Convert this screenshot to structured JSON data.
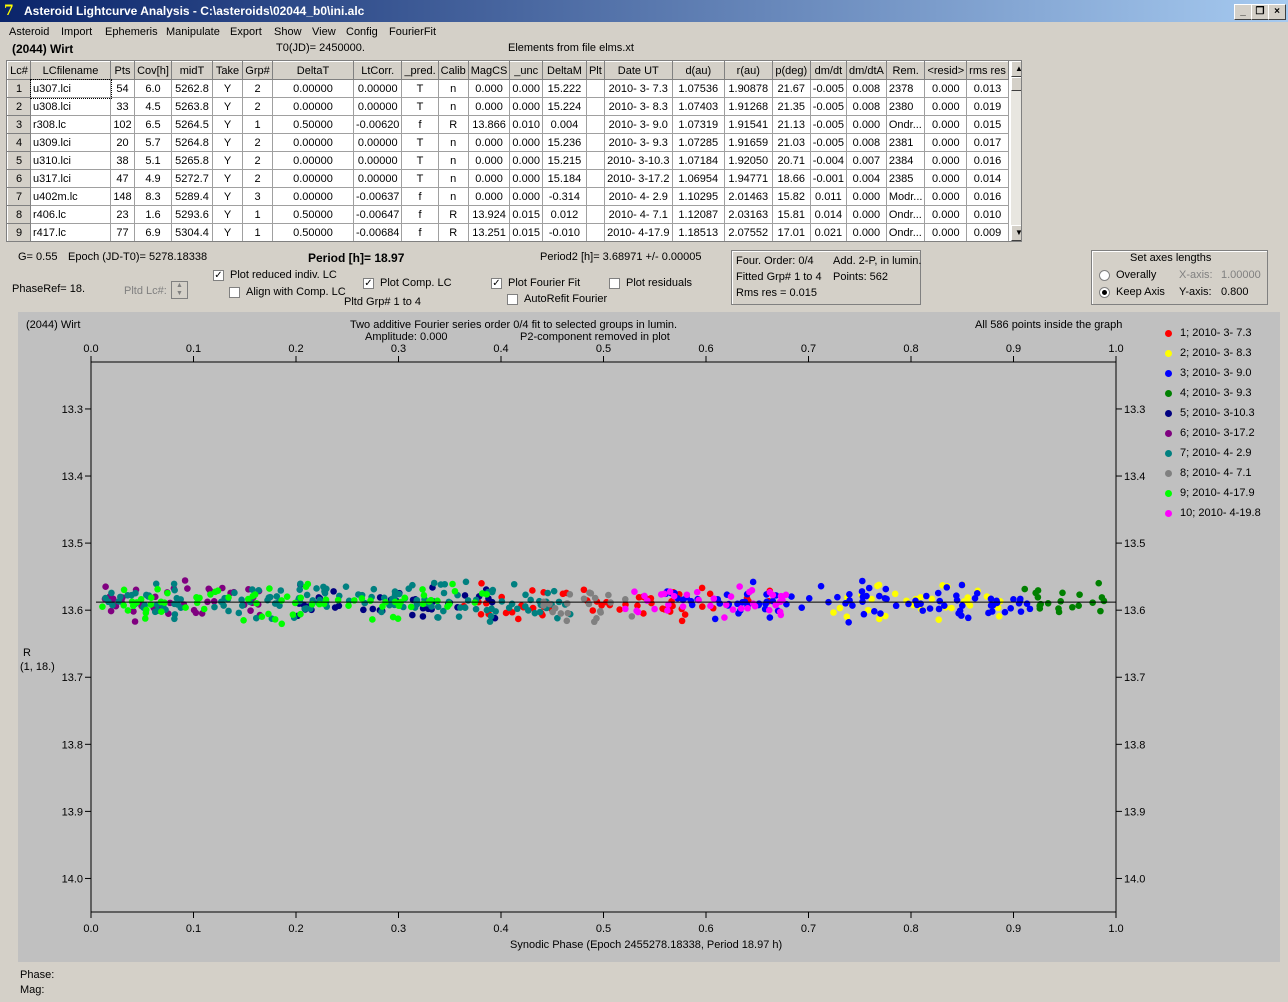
{
  "window": {
    "title": "Asteroid Lightcurve Analysis - C:\\asteroids\\02044_b0\\ini.alc",
    "minimize_label": "_",
    "restore_label": "❐",
    "close_label": "×"
  },
  "menu": [
    "Asteroid",
    "Import",
    "Ephemeris",
    "Manipulate",
    "Export",
    "Show",
    "View",
    "Config",
    "FourierFit"
  ],
  "header": {
    "object": "(2044) Wirt",
    "t0": "T0(JD)= 2450000.",
    "elements": "Elements from file elms.xt"
  },
  "table": {
    "columns": [
      "Lc#",
      "LCfilename",
      "Pts",
      "Cov[h]",
      "midT",
      "Take",
      "Grp#",
      "DeltaT",
      "LtCorr.",
      "_pred.",
      "Calib",
      "MagCS",
      "_unc",
      "DeltaM",
      "Plt",
      "Date UT",
      "d(au)",
      "r(au)",
      "p(deg)",
      "dm/dt",
      "dm/dtA",
      "Rem.",
      "<resid>",
      "rms res"
    ],
    "rows": [
      [
        "1",
        "u307.lci",
        "54",
        "6.0",
        "5262.8",
        "Y",
        "2",
        "0.00000",
        "0.00000",
        "T",
        "n",
        "0.000",
        "0.000",
        "15.222",
        "",
        "2010- 3- 7.3",
        "1.07536",
        "1.90878",
        "21.67",
        "-0.005",
        "0.008",
        "2378",
        "0.000",
        "0.013"
      ],
      [
        "2",
        "u308.lci",
        "33",
        "4.5",
        "5263.8",
        "Y",
        "2",
        "0.00000",
        "0.00000",
        "T",
        "n",
        "0.000",
        "0.000",
        "15.224",
        "",
        "2010- 3- 8.3",
        "1.07403",
        "1.91268",
        "21.35",
        "-0.005",
        "0.008",
        "2380",
        "0.000",
        "0.019"
      ],
      [
        "3",
        "r308.lc",
        "102",
        "6.5",
        "5264.5",
        "Y",
        "1",
        "0.50000",
        "-0.00620",
        "f",
        "R",
        "13.866",
        "0.010",
        "0.004",
        "",
        "2010- 3- 9.0",
        "1.07319",
        "1.91541",
        "21.13",
        "-0.005",
        "0.000",
        "Ondr...",
        "0.000",
        "0.015"
      ],
      [
        "4",
        "u309.lci",
        "20",
        "5.7",
        "5264.8",
        "Y",
        "2",
        "0.00000",
        "0.00000",
        "T",
        "n",
        "0.000",
        "0.000",
        "15.236",
        "",
        "2010- 3- 9.3",
        "1.07285",
        "1.91659",
        "21.03",
        "-0.005",
        "0.008",
        "2381",
        "0.000",
        "0.017"
      ],
      [
        "5",
        "u310.lci",
        "38",
        "5.1",
        "5265.8",
        "Y",
        "2",
        "0.00000",
        "0.00000",
        "T",
        "n",
        "0.000",
        "0.000",
        "15.215",
        "",
        "2010- 3-10.3",
        "1.07184",
        "1.92050",
        "20.71",
        "-0.004",
        "0.007",
        "2384",
        "0.000",
        "0.016"
      ],
      [
        "6",
        "u317.lci",
        "47",
        "4.9",
        "5272.7",
        "Y",
        "2",
        "0.00000",
        "0.00000",
        "T",
        "n",
        "0.000",
        "0.000",
        "15.184",
        "",
        "2010- 3-17.2",
        "1.06954",
        "1.94771",
        "18.66",
        "-0.001",
        "0.004",
        "2385",
        "0.000",
        "0.014"
      ],
      [
        "7",
        "u402m.lc",
        "148",
        "8.3",
        "5289.4",
        "Y",
        "3",
        "0.00000",
        "-0.00637",
        "f",
        "n",
        "0.000",
        "0.000",
        "-0.314",
        "",
        "2010- 4- 2.9",
        "1.10295",
        "2.01463",
        "15.82",
        "0.011",
        "0.000",
        "Modr...",
        "0.000",
        "0.016"
      ],
      [
        "8",
        "r406.lc",
        "23",
        "1.6",
        "5293.6",
        "Y",
        "1",
        "0.50000",
        "-0.00647",
        "f",
        "R",
        "13.924",
        "0.015",
        "0.012",
        "",
        "2010- 4- 7.1",
        "1.12087",
        "2.03163",
        "15.81",
        "0.014",
        "0.000",
        "Ondr...",
        "0.000",
        "0.010"
      ],
      [
        "9",
        "r417.lc",
        "77",
        "6.9",
        "5304.4",
        "Y",
        "1",
        "0.50000",
        "-0.00684",
        "f",
        "R",
        "13.251",
        "0.015",
        "-0.010",
        "",
        "2010- 4-17.9",
        "1.18513",
        "2.07552",
        "17.01",
        "0.021",
        "0.000",
        "Ondr...",
        "0.000",
        "0.009"
      ]
    ]
  },
  "controls": {
    "g": "G= 0.55",
    "epoch": "Epoch (JD-T0)= 5278.18338",
    "period": "Period [h]= 18.97",
    "period2": "Period2 [h]= 3.68971 +/- 0.00005",
    "phaseref": "PhaseRef= 18.",
    "pltd_lc": "Pltd Lc#:",
    "plot_reduced": "Plot reduced indiv. LC",
    "align_comp": "Align with Comp. LC",
    "plot_comp": "Plot Comp. LC",
    "pltd_grp": "Pltd Grp#  1   to   4",
    "plot_fourier": "Plot Fourier Fit",
    "autorefit": "AutoRefit Fourier",
    "plot_residuals": "Plot residuals",
    "four_order": "Four. Order:  0/4",
    "add2p": "Add. 2-P, in lumin.",
    "fitted_grp": "Fitted Grp# 1 to 4",
    "points": "Points: 562",
    "rms": "Rms res     = 0.015",
    "axes_title": "Set axes lengths",
    "overally": "Overally",
    "keep_axis": "Keep Axis",
    "xaxis_label": "X-axis:",
    "xaxis_value": "1.00000",
    "yaxis_label": "Y-axis:",
    "yaxis_value": "0.800"
  },
  "plot": {
    "object": "(2044) Wirt",
    "subtitle1": "Two additive Fourier series order 0/4 fit to selected groups in lumin.",
    "subtitle2": "Amplitude: 0.000",
    "subtitle3": "P2-component removed in plot",
    "points_note": "All 586 points inside the graph",
    "ylabel1": "R",
    "ylabel2": "(1, 18.)",
    "xlabel": "Synodic Phase (Epoch 2455278.18338, Period 18.97 h)"
  },
  "chart_data": {
    "type": "scatter",
    "xlim": [
      0,
      1
    ],
    "ylim": [
      14.05,
      13.23
    ],
    "y_inverted": true,
    "xticks": [
      "0.0",
      "0.1",
      "0.2",
      "0.3",
      "0.4",
      "0.5",
      "0.6",
      "0.7",
      "0.8",
      "0.9",
      "1.0"
    ],
    "yticks": [
      "13.3",
      "13.4",
      "13.5",
      "13.6",
      "13.7",
      "13.8",
      "13.9",
      "14.0"
    ],
    "fit_line": 13.588,
    "series": [
      {
        "name": "1; 2010- 3- 7.3",
        "color": "#ff0000",
        "range": [
          0.35,
          0.67
        ],
        "density": 60
      },
      {
        "name": "2; 2010- 3- 8.3",
        "color": "#ffff00",
        "range": [
          0.72,
          0.89
        ],
        "density": 35
      },
      {
        "name": "3; 2010- 3- 9.0",
        "color": "#0000ff",
        "range": [
          0.56,
          0.92
        ],
        "density": 100
      },
      {
        "name": "4; 2010- 3- 9.3",
        "color": "#008000",
        "range": [
          0.91,
          0.99
        ],
        "density": 20
      },
      {
        "name": "5; 2010- 3-10.3",
        "color": "#000080",
        "range": [
          0.2,
          0.4
        ],
        "density": 38
      },
      {
        "name": "6; 2010- 3-17.2",
        "color": "#800080",
        "range": [
          0.0,
          0.17
        ],
        "density": 45
      },
      {
        "name": "7; 2010- 4- 2.9",
        "color": "#008080",
        "range": [
          0.0,
          0.47
        ],
        "density": 150
      },
      {
        "name": "8; 2010- 4- 7.1",
        "color": "#808080",
        "range": [
          0.44,
          0.53
        ],
        "density": 23
      },
      {
        "name": "9; 2010- 4-17.9",
        "color": "#00ff00",
        "range": [
          0.01,
          0.39
        ],
        "density": 77
      },
      {
        "name": "10; 2010- 4-19.8",
        "color": "#ff00ff",
        "range": [
          0.52,
          0.68
        ],
        "density": 40
      }
    ]
  },
  "status": {
    "phase": "Phase:",
    "mag": "Mag:"
  }
}
